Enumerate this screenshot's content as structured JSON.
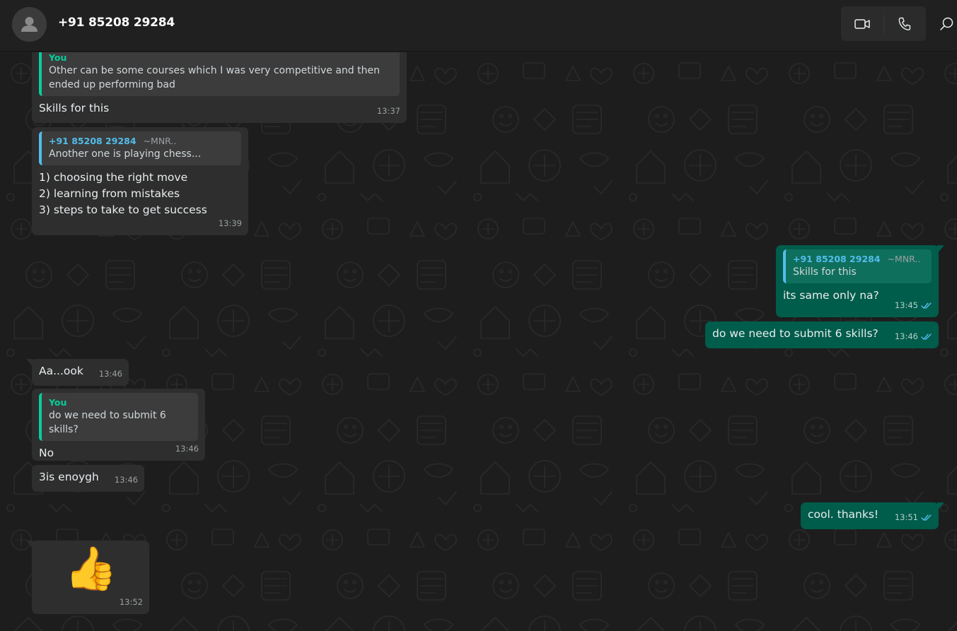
{
  "header": {
    "contact_name": "+91 85208 29284",
    "video_icon": "video-call-icon",
    "voice_icon": "voice-call-icon",
    "search_icon": "search-icon"
  },
  "messages": [
    {
      "direction": "in",
      "quote": {
        "sender": "You",
        "text": "Other can be some courses which I was very competitive and then ended up performing bad"
      },
      "text": "Skills for this",
      "time": "13:37"
    },
    {
      "direction": "in",
      "quote": {
        "sender": "+91 85208 29284",
        "alias": "~MNR..",
        "text": "Another one is playing chess..."
      },
      "lines": [
        "1) choosing the right move",
        "2) learning from mistakes",
        "3) steps to take to get success"
      ],
      "time": "13:39"
    },
    {
      "direction": "out",
      "quote": {
        "sender": "+91 85208 29284",
        "alias": "~MNR..",
        "text": "Skills for this"
      },
      "text": "its same only na?",
      "time": "13:45",
      "status": "read"
    },
    {
      "direction": "out",
      "text": "do we need to submit 6 skills?",
      "time": "13:46",
      "status": "read"
    },
    {
      "direction": "in",
      "text": "Aa...ook",
      "time": "13:46"
    },
    {
      "direction": "in",
      "quote": {
        "sender": "You",
        "text": "do we need to submit 6 skills?"
      },
      "text": "No",
      "time": "13:46"
    },
    {
      "direction": "in",
      "text": "3is enoygh",
      "time": "13:46"
    },
    {
      "direction": "out",
      "text": "cool. thanks!",
      "time": "13:51",
      "status": "read"
    },
    {
      "direction": "in",
      "emoji": "👍",
      "time": "13:52"
    }
  ],
  "colors": {
    "incoming_bubble": "#2e2e2e",
    "outgoing_bubble": "#005c4b",
    "quote_you": "#06cf9c",
    "quote_contact": "#53bdeb",
    "read_ticks": "#53bdeb"
  }
}
